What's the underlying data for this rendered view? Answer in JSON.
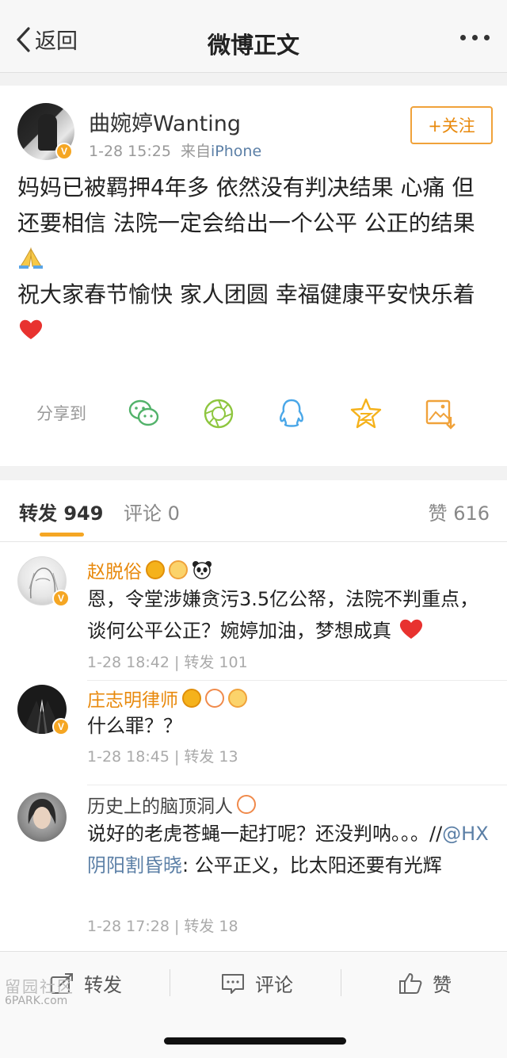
{
  "nav": {
    "back_label": "返回",
    "title": "微博正文"
  },
  "post": {
    "author": "曲婉婷Wanting",
    "time": "1-28 15:25",
    "source_prefix": "来自",
    "source": "iPhone",
    "follow_label": "+关注",
    "text_p1": "妈妈已被羁押4年多 依然没有判决结果 心痛 但还要相信 法院一定会给出一个公平 公正的结果",
    "text_p2": "祝大家春节愉快 家人团圆 幸福健康平安快乐着",
    "share_label": "分享到",
    "share_icons": [
      "wechat-icon",
      "moments-icon",
      "qq-icon",
      "qzone-star-icon",
      "save-image-icon"
    ]
  },
  "tabs": {
    "repost_label": "转发",
    "repost_count": "949",
    "comment_label": "评论",
    "comment_count": "0",
    "like_label": "赞",
    "like_count": "616"
  },
  "reposts": [
    {
      "name": "赵脱俗",
      "text": "恩，令堂涉嫌贪污3.5亿公帑，法院不判重点，谈何公平公正？婉婷加油，梦想成真",
      "meta": "1-28 18:42 | 转发 101"
    },
    {
      "name": "庄志明律师",
      "text": "什么罪？？",
      "meta": "1-28 18:45 | 转发 13"
    },
    {
      "name": "历史上的脑顶洞人",
      "text_a": "说好的老虎苍蝇一起打呢？还没判呐。。。//",
      "mention": "@HX阴阳割昏晓",
      "text_b": ": 公平正义，比太阳还要有光辉",
      "meta": "1-28 17:28 | 转发 18"
    }
  ],
  "toolbar": {
    "repost_label": "转发",
    "comment_label": "评论",
    "like_label": "赞"
  },
  "watermark": {
    "line1": "留园社区",
    "line2": "6PARK.com"
  },
  "colors": {
    "accent": "#f5a623",
    "follow": "#e8890c",
    "link": "#5b7fa6"
  }
}
